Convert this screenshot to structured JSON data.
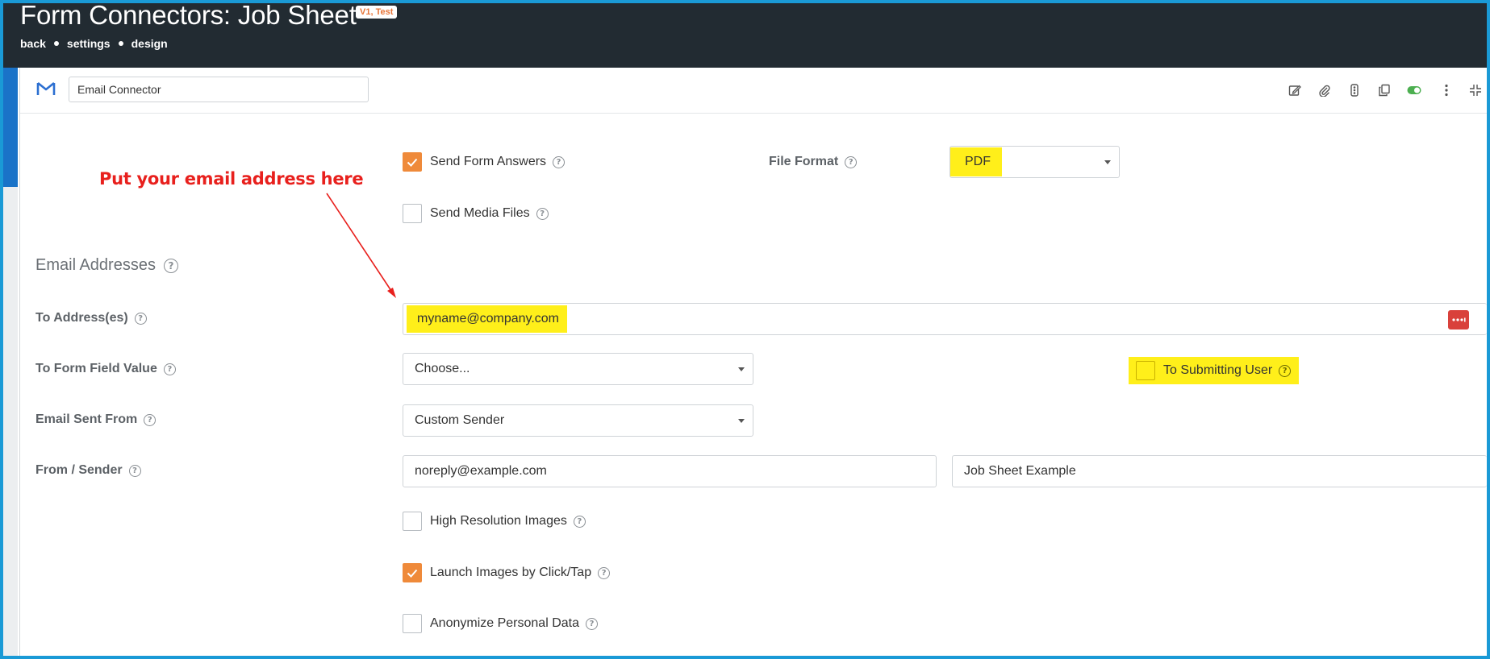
{
  "header": {
    "title": "Form Connectors: Job Sheet",
    "version_badge": "V1, Test",
    "breadcrumbs": [
      "back",
      "settings",
      "design"
    ]
  },
  "connector": {
    "name": "Email Connector",
    "icon": "gmail-icon",
    "toolbar_icons": [
      "edit-icon",
      "attachment-icon",
      "traffic-light-icon",
      "copy-icon",
      "toggle-icon",
      "more-vertical-icon",
      "collapse-icon"
    ]
  },
  "annotation": {
    "text": "Put your email address here",
    "color": "#e8201d"
  },
  "options": {
    "send_form_answers": {
      "label": "Send Form Answers",
      "checked": true
    },
    "send_media_files": {
      "label": "Send Media Files",
      "checked": false
    },
    "file_format": {
      "label": "File Format",
      "value": "PDF"
    }
  },
  "email_section": {
    "title": "Email Addresses",
    "to_addresses": {
      "label": "To Address(es)",
      "value": "myname@company.com"
    },
    "to_form_field": {
      "label": "To Form Field Value",
      "value": "Choose..."
    },
    "to_submitting_user": {
      "label": "To Submitting User",
      "checked": false
    },
    "email_sent_from": {
      "label": "Email Sent From",
      "value": "Custom Sender"
    },
    "from_sender": {
      "label": "From / Sender",
      "email": "noreply@example.com",
      "name": "Job Sheet Example"
    }
  },
  "extras": {
    "high_resolution_images": {
      "label": "High Resolution Images",
      "checked": false
    },
    "launch_images": {
      "label": "Launch Images by Click/Tap",
      "checked": true
    },
    "anonymize": {
      "label": "Anonymize Personal Data",
      "checked": false
    }
  },
  "colors": {
    "accent": "#ef8a3a",
    "highlight": "#ffef1a",
    "header_bg": "#222b32",
    "frame": "#1a9ad6",
    "danger": "#d9413b"
  }
}
